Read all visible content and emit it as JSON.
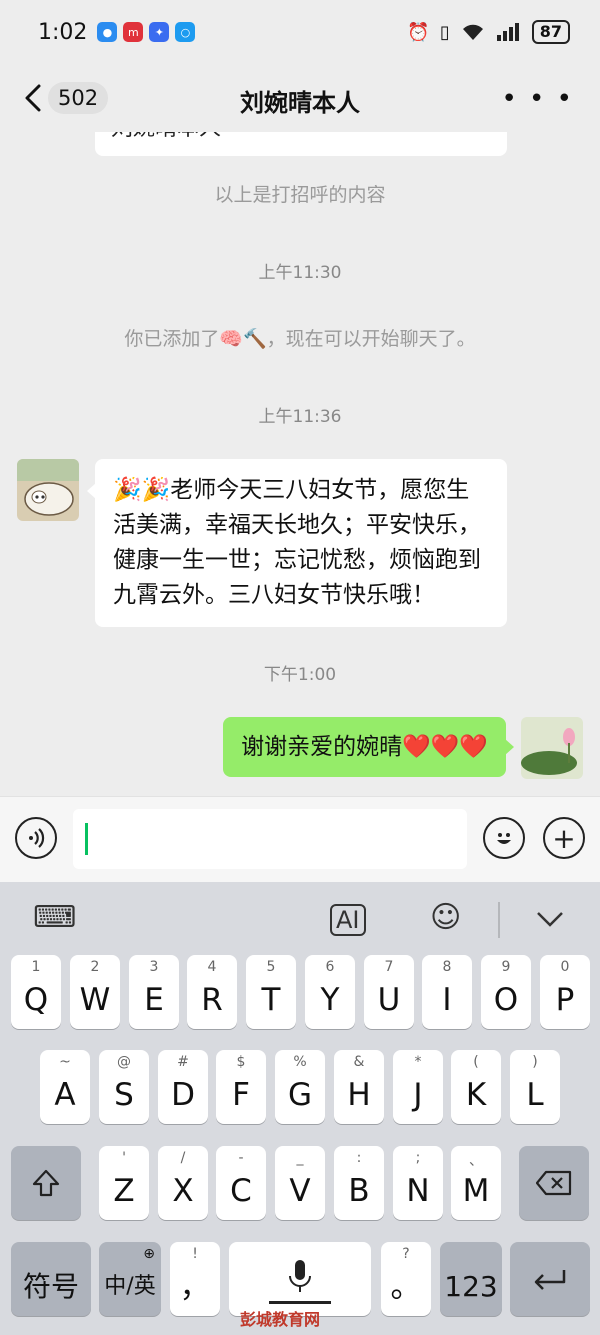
{
  "status_bar": {
    "time": "1:02",
    "battery": "87",
    "notif_icons": [
      "chat-app-icon",
      "mi-app-icon",
      "bulb-app-icon",
      "search-app-icon"
    ]
  },
  "nav": {
    "unread_count": "502",
    "title": "刘婉晴本人"
  },
  "chat": {
    "cut_bubble_text": "刘婉晴本人",
    "greeting_notice": "以上是打招呼的内容",
    "messages": [
      {
        "type": "time",
        "text": "上午11:30"
      },
      {
        "type": "system",
        "text": "你已添加了🧠🔨，现在可以开始聊天了。"
      },
      {
        "type": "time",
        "text": "上午11:36"
      },
      {
        "type": "incoming",
        "text": "🎉🎉老师今天三八妇女节，愿您生活美满，幸福天长地久；平安快乐，健康一生一世；忘记忧愁，烦恼跑到九霄云外。三八妇女节快乐哦！"
      },
      {
        "type": "time",
        "text": "下午1:00"
      },
      {
        "type": "outgoing",
        "text": "谢谢亲爱的婉晴❤️❤️❤️"
      }
    ]
  },
  "keyboard": {
    "rows": [
      [
        {
          "k": "Q",
          "h": "1"
        },
        {
          "k": "W",
          "h": "2"
        },
        {
          "k": "E",
          "h": "3"
        },
        {
          "k": "R",
          "h": "4"
        },
        {
          "k": "T",
          "h": "5"
        },
        {
          "k": "Y",
          "h": "6"
        },
        {
          "k": "U",
          "h": "7"
        },
        {
          "k": "I",
          "h": "8"
        },
        {
          "k": "O",
          "h": "9"
        },
        {
          "k": "P",
          "h": "0"
        }
      ],
      [
        {
          "k": "A",
          "h": "~"
        },
        {
          "k": "S",
          "h": "@"
        },
        {
          "k": "D",
          "h": "#"
        },
        {
          "k": "F",
          "h": "$"
        },
        {
          "k": "G",
          "h": "%"
        },
        {
          "k": "H",
          "h": "&"
        },
        {
          "k": "J",
          "h": "*"
        },
        {
          "k": "K",
          "h": "("
        },
        {
          "k": "L",
          "h": ")"
        }
      ],
      [
        {
          "k": "Z",
          "h": "'"
        },
        {
          "k": "X",
          "h": "/"
        },
        {
          "k": "C",
          "h": "-"
        },
        {
          "k": "V",
          "h": "_"
        },
        {
          "k": "B",
          "h": ":"
        },
        {
          "k": "N",
          "h": ";"
        },
        {
          "k": "M",
          "h": "、"
        }
      ]
    ],
    "symbol_key": "符号",
    "lang_key": "中/英",
    "comma_key": "，",
    "comma_hint": "!",
    "period_key": "。",
    "period_hint": "?",
    "num_key": "123"
  },
  "watermark": "彭城教育网"
}
